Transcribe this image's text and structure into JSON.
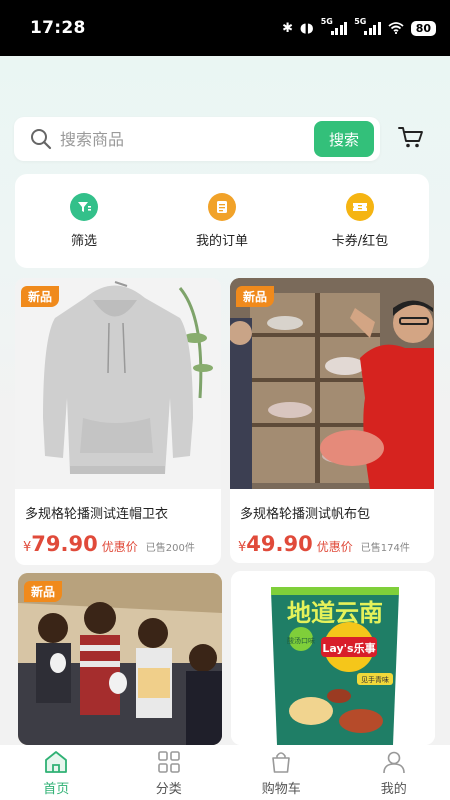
{
  "status_bar": {
    "time": "17:28",
    "network_1": "5G",
    "network_2": "5G",
    "battery": "80"
  },
  "search": {
    "placeholder": "搜索商品",
    "button_label": "搜索"
  },
  "quick_menu": [
    {
      "label": "筛选",
      "icon": "filter-icon",
      "color": "#33c08a"
    },
    {
      "label": "我的订单",
      "icon": "order-icon",
      "color": "#f1a229"
    },
    {
      "label": "卡券/红包",
      "icon": "coupon-icon",
      "color": "#f5b412"
    }
  ],
  "products": [
    {
      "badge": "新品",
      "title": "多规格轮播测试连帽卫衣",
      "currency": "¥",
      "price": "79.90",
      "discount_label": "优惠价",
      "sold": "已售200件",
      "image": "gray-hoodie"
    },
    {
      "badge": "新品",
      "title": "多规格轮播测试帆布包",
      "currency": "¥",
      "price": "49.90",
      "discount_label": "优惠价",
      "sold": "已售174件",
      "image": "man-in-red-shirt-with-crystals"
    },
    {
      "badge": "新品",
      "image": "group-of-children"
    },
    {
      "image": "lays-chips-bag",
      "image_text": {
        "line1": "地道云南",
        "brand": "Lay's乐事",
        "flavor_tag": "酸汤口味",
        "flavor": "见手青味"
      }
    }
  ],
  "tab_bar": [
    {
      "label": "首页",
      "icon": "home-icon",
      "active": true
    },
    {
      "label": "分类",
      "icon": "category-icon",
      "active": false
    },
    {
      "label": "购物车",
      "icon": "cart-icon",
      "active": false
    },
    {
      "label": "我的",
      "icon": "user-icon",
      "active": false
    }
  ],
  "colors": {
    "accent": "#33c07a",
    "price": "#e04a3a",
    "badge": "#f08a1c"
  }
}
